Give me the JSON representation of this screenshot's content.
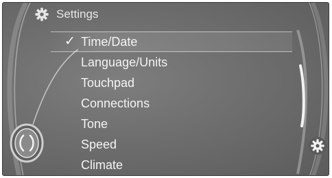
{
  "header": {
    "title": "Settings",
    "icon": "gear-icon"
  },
  "menu": {
    "items": [
      {
        "label": "Time/Date",
        "selected": true
      },
      {
        "label": "Language/Units",
        "selected": false
      },
      {
        "label": "Touchpad",
        "selected": false
      },
      {
        "label": "Connections",
        "selected": false
      },
      {
        "label": "Tone",
        "selected": false
      },
      {
        "label": "Speed",
        "selected": false
      },
      {
        "label": "Climate",
        "selected": false
      }
    ],
    "check_mark": "✓"
  },
  "controller": {
    "icon": "controller-knob-icon"
  },
  "options_button": {
    "icon": "gear-icon"
  },
  "colors": {
    "background": "#6e6e6e",
    "text": "#f4f4f4",
    "accent_line": "#e8e8e8"
  }
}
